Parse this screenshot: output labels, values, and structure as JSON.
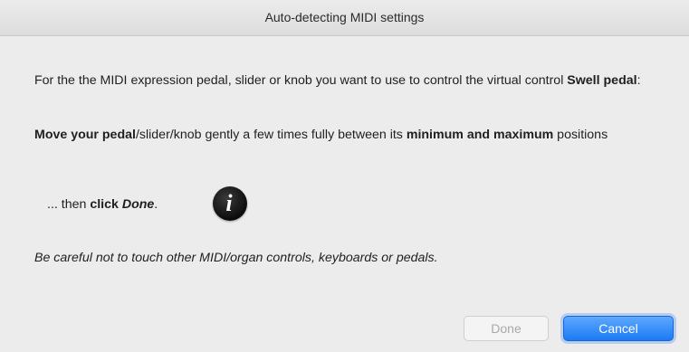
{
  "window": {
    "title": "Auto-detecting MIDI settings"
  },
  "instructions": {
    "p1_prefix": "For the the MIDI expression pedal, slider or knob you want to use to control the virtual control ",
    "p1_bold": "Swell pedal",
    "p1_suffix": ":",
    "p2_bold1": "Move your pedal",
    "p2_mid": "/slider/knob gently a few times fully between its ",
    "p2_bold2": "minimum and maximum",
    "p2_suffix": " positions",
    "p3_prefix": "... then ",
    "p3_bold": "click ",
    "p3_bold_italic": "Done",
    "p3_suffix": ".",
    "p4": "Be careful not to touch other MIDI/organ controls, keyboards or pedals."
  },
  "info_icon": {
    "glyph": "i",
    "icon": "info-icon"
  },
  "buttons": {
    "done_label": "Done",
    "done_enabled": false,
    "cancel_label": "Cancel"
  },
  "colors": {
    "accent": "#1c7af2",
    "background": "#ececec"
  }
}
